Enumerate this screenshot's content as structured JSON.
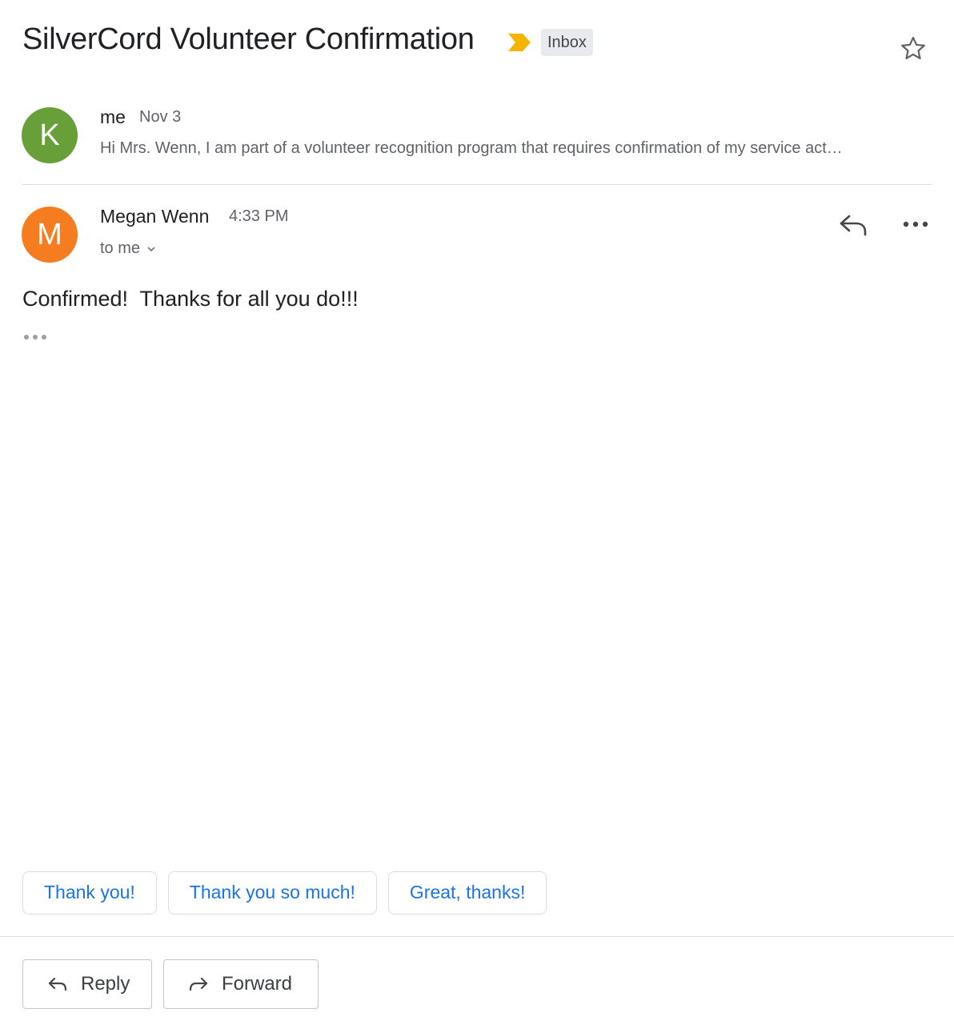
{
  "thread": {
    "subject": "SilverCord Volunteer Confirmation",
    "label": "Inbox",
    "importance_color": "#f4b400",
    "star_icon": "star-outline-icon"
  },
  "messages": [
    {
      "avatar_letter": "K",
      "avatar_color": "#689f38",
      "sender": "me",
      "date": "Nov 3",
      "snippet": "Hi Mrs. Wenn, I am part of a volunteer recognition program that requires confirmation of my service act…"
    },
    {
      "avatar_letter": "M",
      "avatar_color": "#f57c1f",
      "sender": "Megan Wenn",
      "date": "4:33 PM",
      "recipient": "to me",
      "body": "Confirmed!  Thanks for all you do!!!"
    }
  ],
  "smart_replies": [
    "Thank you!",
    "Thank you so much!",
    "Great, thanks!"
  ],
  "actions": {
    "reply_label": "Reply",
    "forward_label": "Forward"
  },
  "colors": {
    "link_blue": "#1a73e8",
    "secondary_text": "#5f6368",
    "divider": "#dadce0"
  }
}
